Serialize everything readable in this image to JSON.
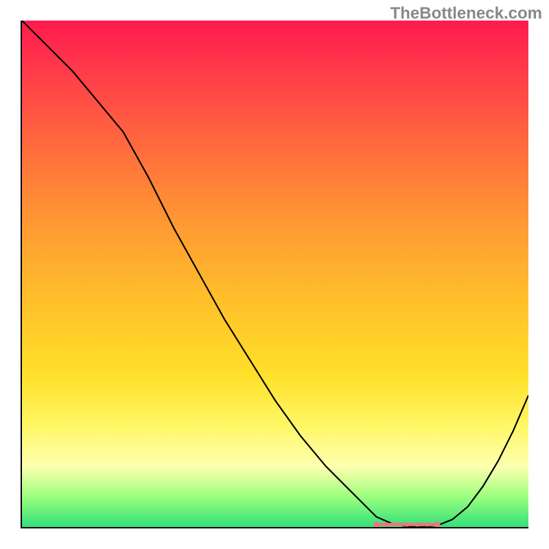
{
  "watermark": "TheBottleneck.com",
  "chart_data": {
    "type": "line",
    "title": "",
    "xlabel": "",
    "ylabel": "",
    "ylim": [
      0,
      100
    ],
    "xlim": [
      0,
      100
    ],
    "series": [
      {
        "name": "bottleneck-curve",
        "x": [
          0,
          5,
          10,
          15,
          20,
          25,
          30,
          35,
          40,
          45,
          50,
          55,
          60,
          65,
          68,
          70,
          73,
          76,
          79,
          82,
          85,
          88,
          91,
          94,
          97,
          100
        ],
        "values": [
          100,
          95,
          90,
          84,
          78,
          69,
          59,
          50,
          41,
          33,
          25,
          18,
          12,
          7,
          4,
          2,
          0.7,
          0.1,
          0.0,
          0.3,
          1.5,
          4,
          8,
          13,
          19,
          26
        ]
      }
    ],
    "background_gradient": {
      "top": "#ff1a4d",
      "mid": "#ffd633",
      "bottom": "#33e07a"
    },
    "optimum_region": {
      "x_start": 73,
      "x_end": 82
    },
    "markers": [
      {
        "name": "optimum-marker",
        "x_range": [
          70,
          82
        ],
        "y": 0.5,
        "color": "#e67a7a"
      }
    ]
  }
}
